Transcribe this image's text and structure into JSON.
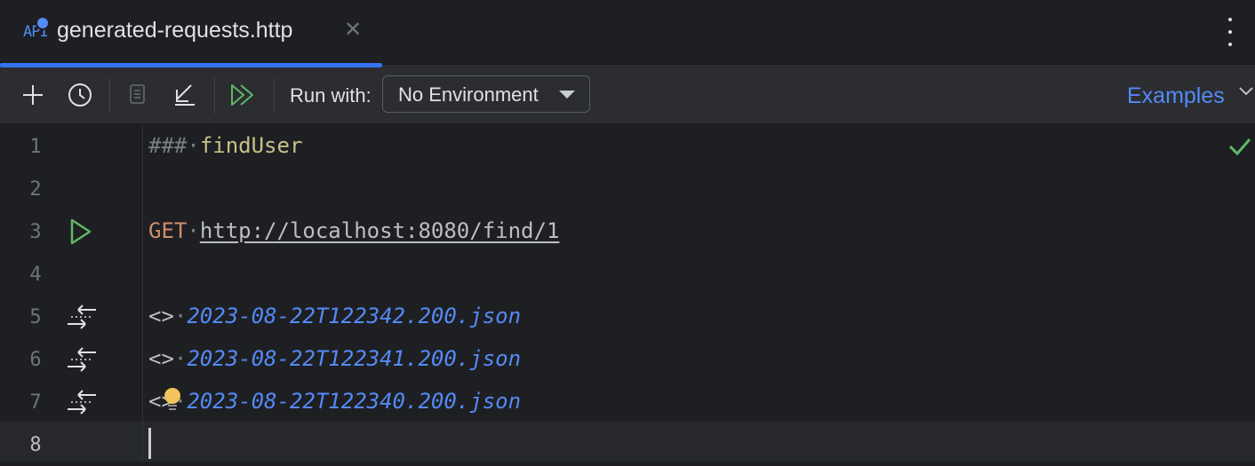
{
  "tab": {
    "title": "generated-requests.http",
    "icon": "api-icon",
    "icon_text": "API",
    "close": "✕"
  },
  "toolbar": {
    "add": "add-icon",
    "history": "history-icon",
    "run_label": "Run with:",
    "environment": "No Environment",
    "examples": "Examples"
  },
  "editor": {
    "lines": [
      {
        "num": "1",
        "hash": "###",
        "name": "findUser"
      },
      {
        "num": "2"
      },
      {
        "num": "3",
        "method": "GET",
        "url": "http://localhost:8080/find/1"
      },
      {
        "num": "4"
      },
      {
        "num": "5",
        "arrow": "<>",
        "file": "2023-08-22T122342.200.json"
      },
      {
        "num": "6",
        "arrow": "<>",
        "file": "2023-08-22T122341.200.json"
      },
      {
        "num": "7",
        "arrow": "<>",
        "file": "2023-08-22T122340.200.json"
      },
      {
        "num": "8"
      }
    ]
  },
  "colors": {
    "accent": "#3574f0",
    "link": "#548af7",
    "run": "#5fb865",
    "check": "#5fb865"
  }
}
